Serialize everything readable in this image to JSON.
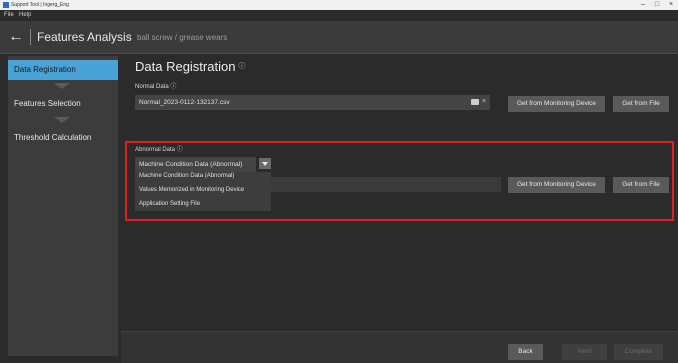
{
  "window": {
    "title": "Support Tool | Ingerg_Eng",
    "controls": [
      "–",
      "□",
      "×"
    ]
  },
  "menu": {
    "file": "File",
    "help": "Help"
  },
  "header": {
    "back_icon": "←",
    "title": "Features Analysis",
    "crumb_sep": ">",
    "breadcrumb": "ball screw / grease wears"
  },
  "sidebar": {
    "steps": [
      {
        "label": "Data Registration",
        "active": true
      },
      {
        "label": "Features Selection",
        "active": false
      },
      {
        "label": "Threshold Calculation",
        "active": false
      }
    ]
  },
  "main": {
    "title": "Data Registration",
    "info_icon": "ⓘ",
    "normal": {
      "label": "Normal Data",
      "value": "Normal_2023-0112-132137.csv",
      "clear_icon": "×"
    },
    "abnormal": {
      "label": "Abnormal Data",
      "selected": "Machine Condition Data (Abnormal)",
      "options": [
        "Machine Condition Data (Abnormal)",
        "Values Memorized in Monitoring Device",
        "Application Setting File"
      ]
    },
    "buttons": {
      "get_monitor": "Get from Monitoring Device",
      "get_file": "Get from File"
    },
    "footer": {
      "back": "Back",
      "next": "Next",
      "complete": "Complete"
    }
  },
  "colors": {
    "accent": "#4aa3d6",
    "highlight": "#e02020"
  }
}
